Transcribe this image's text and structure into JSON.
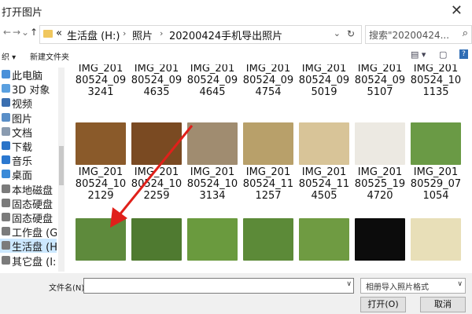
{
  "window": {
    "title": "打开图片",
    "close_glyph": "✕"
  },
  "address": {
    "crumbs": [
      "«",
      "生活盘 (H:)",
      "照片",
      "20200424手机导出照片"
    ],
    "separators": [
      "›",
      "›"
    ],
    "search_placeholder": "搜索\"20200424...",
    "nav": {
      "back": "←",
      "forward": "→",
      "dropdown": "⌄",
      "up": "↑",
      "refresh": "↻",
      "search": "⌕"
    }
  },
  "toolbar": {
    "organize": "织 ▾",
    "new_folder": "新建文件夹",
    "view_glyph": "▤ ▾",
    "pane_glyph": "▢",
    "help_glyph": "?"
  },
  "sidebar": {
    "items": [
      {
        "label": "此电脑",
        "color": "#4a90d9"
      },
      {
        "label": "3D 对象",
        "color": "#5aa0e0"
      },
      {
        "label": "视频",
        "color": "#3b6fb0"
      },
      {
        "label": "图片",
        "color": "#5a8fc8"
      },
      {
        "label": "文档",
        "color": "#8a9bb0"
      },
      {
        "label": "下载",
        "color": "#2a73c8"
      },
      {
        "label": "音乐",
        "color": "#2b78d0"
      },
      {
        "label": "桌面",
        "color": "#3a8ad8"
      },
      {
        "label": "本地磁盘 (",
        "color": "#7b7b7b"
      },
      {
        "label": "固态硬盘 (",
        "color": "#7b7b7b"
      },
      {
        "label": "固态硬盘 (",
        "color": "#7b7b7b"
      },
      {
        "label": "工作盘 (G:",
        "color": "#7b7b7b"
      },
      {
        "label": "生活盘 (H:",
        "color": "#7b7b7b",
        "selected": true
      },
      {
        "label": "其它盘 (I:)",
        "color": "#7b7b7b"
      }
    ]
  },
  "files": {
    "row1": [
      "IMG_201\n80524_09\n3241",
      "IMG_201\n80524_09\n4635",
      "IMG_201\n80524_09\n4645",
      "IMG_201\n80524_09\n4754",
      "IMG_201\n80524_09\n5019",
      "IMG_201\n80524_09\n5107",
      "IMG_201\n80524_10\n1135"
    ],
    "row2": [
      "IMG_201\n80524_10\n2129",
      "IMG_201\n80524_10\n2259",
      "IMG_201\n80524_10\n3134",
      "IMG_201\n80524_11\n1257",
      "IMG_201\n80524_11\n4505",
      "IMG_201\n80525_19\n4720",
      "IMG_201\n80529_07\n1054"
    ],
    "row1_thumb_colors": [
      "#8a5a2a",
      "#7a4a22",
      "#a08c70",
      "#b8a06a",
      "#d8c498",
      "#ece9e2",
      "#6a9a45"
    ],
    "row2_thumb_colors": [
      "#5e8a3c",
      "#4f7a30",
      "#6a9a3e",
      "#5c8a38",
      "#6f9b42",
      "#0c0c0c",
      "#e8dfb8"
    ]
  },
  "bottom": {
    "filename_label": "文件名(N):",
    "filename_value": "",
    "filetype_value": "相册导入照片格式",
    "open_button": "打开(O)",
    "cancel_button": "取消",
    "drop_glyph": "∨"
  }
}
